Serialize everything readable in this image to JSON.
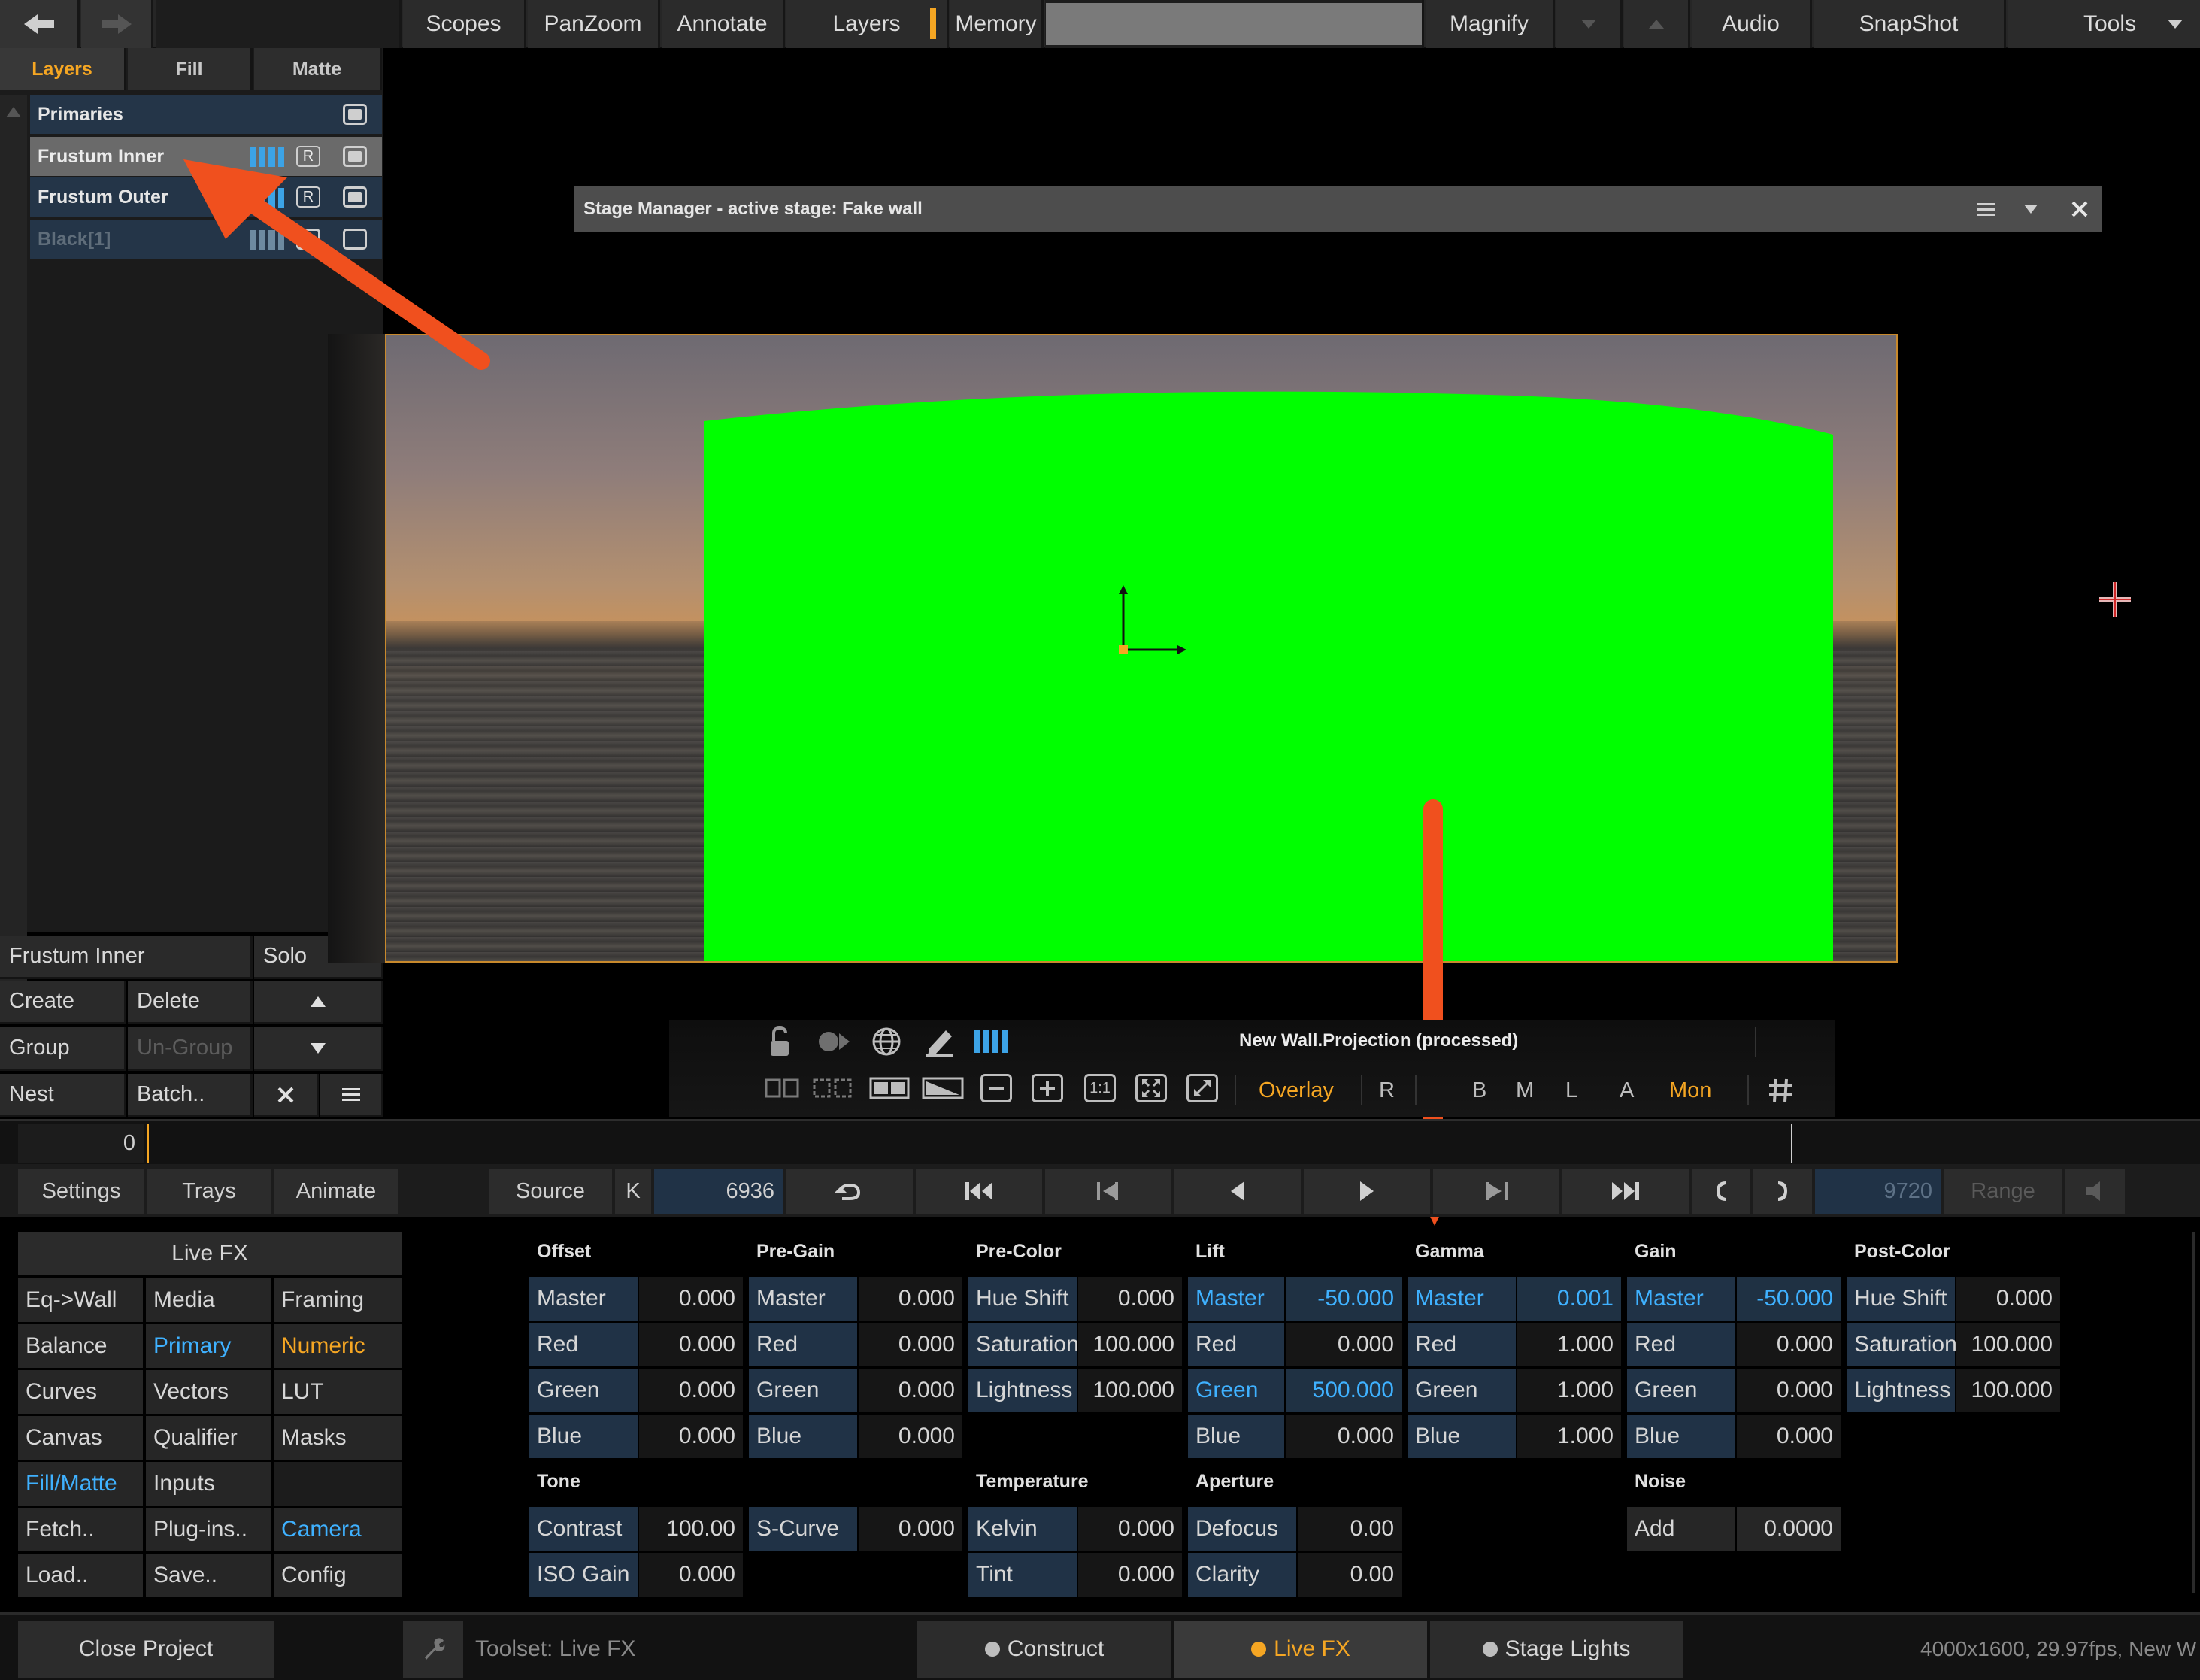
{
  "topbar": {
    "items": [
      "Scopes",
      "PanZoom",
      "Annotate",
      "Layers",
      "Memory",
      "Magnify",
      "Audio",
      "SnapShot",
      "Tools"
    ]
  },
  "layers_panel": {
    "tabs": [
      "Layers",
      "Fill",
      "Matte"
    ],
    "rows": [
      "Primaries",
      "Frustum Inner",
      "Frustum Outer",
      "Black[1]"
    ],
    "r_badge": "R",
    "selected_name": "Frustum Inner",
    "solo": "Solo",
    "buttons": {
      "create": "Create",
      "delete": "Delete",
      "group": "Group",
      "ungroup": "Un-Group",
      "nest": "Nest",
      "batch": "Batch.."
    }
  },
  "stage_manager": {
    "title": "Stage Manager - active stage: Fake wall"
  },
  "viewer_tools": {
    "title": "New Wall.Projection (processed)",
    "one_to_one": "1:1",
    "overlay": "Overlay",
    "r": "R",
    "b": "B",
    "m": "M",
    "l": "L",
    "a": "A",
    "mon": "Mon"
  },
  "timeline": {
    "start": "0"
  },
  "transport": {
    "settings": "Settings",
    "trays": "Trays",
    "animate": "Animate",
    "source": "Source",
    "k": "K",
    "frame": "6936",
    "end_frame": "9720",
    "range": "Range"
  },
  "fx_menu": {
    "header": "Live FX",
    "items": [
      [
        "Eq->Wall",
        "Media",
        "Framing"
      ],
      [
        "Balance",
        "Primary",
        "Numeric"
      ],
      [
        "Curves",
        "Vectors",
        "LUT"
      ],
      [
        "Canvas",
        "Qualifier",
        "Masks"
      ],
      [
        "Fill/Matte",
        "Inputs",
        ""
      ],
      [
        "Fetch..",
        "Plug-ins..",
        "Camera"
      ],
      [
        "Load..",
        "Save..",
        "Config"
      ]
    ]
  },
  "params": {
    "offset": {
      "title": "Offset",
      "rows": [
        [
          "Master",
          "0.000"
        ],
        [
          "Red",
          "0.000"
        ],
        [
          "Green",
          "0.000"
        ],
        [
          "Blue",
          "0.000"
        ]
      ]
    },
    "pregain": {
      "title": "Pre-Gain",
      "rows": [
        [
          "Master",
          "0.000"
        ],
        [
          "Red",
          "0.000"
        ],
        [
          "Green",
          "0.000"
        ],
        [
          "Blue",
          "0.000"
        ]
      ]
    },
    "precolor": {
      "title": "Pre-Color",
      "rows": [
        [
          "Hue Shift",
          "0.000"
        ],
        [
          "Saturation",
          "100.000"
        ],
        [
          "Lightness",
          "100.000"
        ]
      ]
    },
    "lift": {
      "title": "Lift",
      "rows": [
        [
          "Master",
          "-50.000"
        ],
        [
          "Red",
          "0.000"
        ],
        [
          "Green",
          "500.000"
        ],
        [
          "Blue",
          "0.000"
        ]
      ]
    },
    "gamma": {
      "title": "Gamma",
      "rows": [
        [
          "Master",
          "0.001"
        ],
        [
          "Red",
          "1.000"
        ],
        [
          "Green",
          "1.000"
        ],
        [
          "Blue",
          "1.000"
        ]
      ]
    },
    "gain": {
      "title": "Gain",
      "rows": [
        [
          "Master",
          "-50.000"
        ],
        [
          "Red",
          "0.000"
        ],
        [
          "Green",
          "0.000"
        ],
        [
          "Blue",
          "0.000"
        ]
      ]
    },
    "postcolor": {
      "title": "Post-Color",
      "rows": [
        [
          "Hue Shift",
          "0.000"
        ],
        [
          "Saturation",
          "100.000"
        ],
        [
          "Lightness",
          "100.000"
        ]
      ]
    },
    "tone": {
      "title": "Tone",
      "rows": [
        [
          "Contrast",
          "100.00"
        ],
        [
          "S-Curve",
          "0.000"
        ],
        [
          "ISO Gain",
          "0.000"
        ]
      ]
    },
    "temperature": {
      "title": "Temperature",
      "rows": [
        [
          "Kelvin",
          "0.000"
        ],
        [
          "Tint",
          "0.000"
        ]
      ]
    },
    "aperture": {
      "title": "Aperture",
      "rows": [
        [
          "Defocus",
          "0.00"
        ],
        [
          "Clarity",
          "0.00"
        ]
      ]
    },
    "noise": {
      "title": "Noise",
      "rows": [
        [
          "Add",
          "0.0000"
        ]
      ]
    }
  },
  "footer": {
    "close_project": "Close Project",
    "toolset": "Toolset: Live FX",
    "construct": "Construct",
    "livefx": "Live FX",
    "stage_lights": "Stage Lights",
    "status": "4000x1600, 29.97fps, New W"
  },
  "colors": {
    "accent_orange": "#f5a623",
    "highlight_blue": "#3fb1ff",
    "green_screen": "#00ff00",
    "arrow": "#f0501e"
  }
}
